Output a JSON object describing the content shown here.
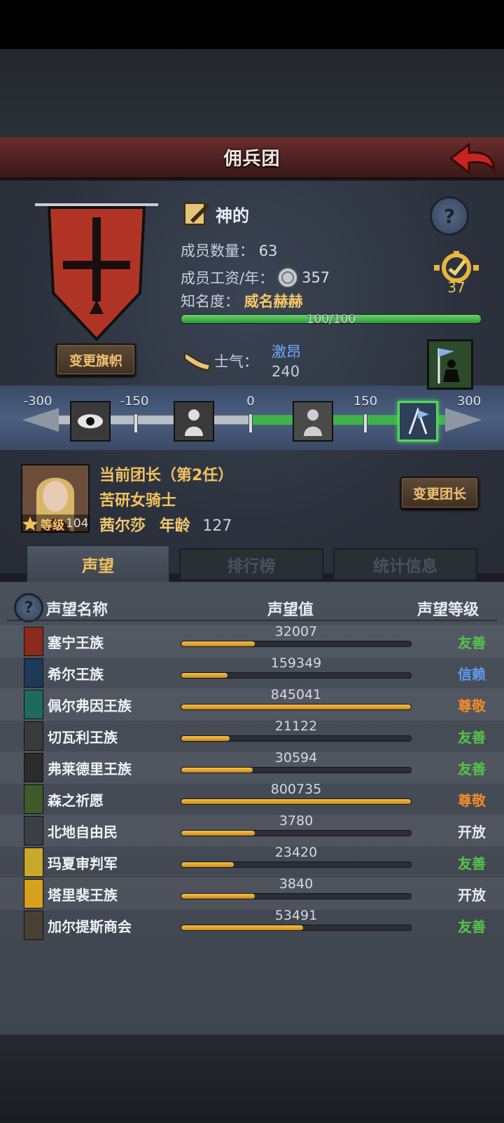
{
  "header": {
    "title": "佣兵团"
  },
  "company": {
    "name": "神的",
    "members_label": "成员数量：",
    "members_value": "63",
    "wage_label": "成员工资/年：",
    "wage_value": "357",
    "fame_label": "知名度：",
    "fame_value": "威名赫赫",
    "fame_progress_text": "100/100",
    "fame_progress": 1.0,
    "badge_value": "37",
    "change_banner_label": "变更旗帜"
  },
  "morale": {
    "label": "士气：",
    "state": "激昂",
    "value": "240",
    "scale_ticks": [
      "-300",
      "-150",
      "0",
      "150",
      "300"
    ]
  },
  "leader": {
    "title": "当前团长（第2任）",
    "class": "苦研女骑士",
    "name": "茜尔莎",
    "age_label": "年龄",
    "age_value": "127",
    "level_label": "等级",
    "level_value": "104",
    "change_leader_label": "变更团长"
  },
  "tabs": [
    {
      "label": "声望"
    },
    {
      "label": "排行榜"
    },
    {
      "label": "统计信息"
    }
  ],
  "reputation": {
    "col_name": "声望名称",
    "col_value": "声望值",
    "col_level": "声望等级",
    "rows": [
      {
        "name": "塞宁王族",
        "value": "32007",
        "progress": 0.32,
        "level": "友善",
        "level_color": "#55c24a",
        "crest_color": "#8a2a1c"
      },
      {
        "name": "希尔王族",
        "value": "159349",
        "progress": 0.2,
        "level": "信赖",
        "level_color": "#5d9cf0",
        "crest_color": "#1f3a58"
      },
      {
        "name": "佩尔弗因王族",
        "value": "845041",
        "progress": 1.0,
        "level": "尊敬",
        "level_color": "#f08a2a",
        "crest_color": "#1e6a5e"
      },
      {
        "name": "切瓦利王族",
        "value": "21122",
        "progress": 0.21,
        "level": "友善",
        "level_color": "#55c24a",
        "crest_color": "#3a3a3a"
      },
      {
        "name": "弗莱德里王族",
        "value": "30594",
        "progress": 0.31,
        "level": "友善",
        "level_color": "#55c24a",
        "crest_color": "#2b2b2b"
      },
      {
        "name": "森之祈愿",
        "value": "800735",
        "progress": 1.0,
        "level": "尊敬",
        "level_color": "#f08a2a",
        "crest_color": "#3d5a28"
      },
      {
        "name": "北地自由民",
        "value": "3780",
        "progress": 0.32,
        "level": "开放",
        "level_color": "#e8ecf2",
        "crest_color": "#3a3f47"
      },
      {
        "name": "玛夏审判军",
        "value": "23420",
        "progress": 0.23,
        "level": "友善",
        "level_color": "#55c24a",
        "crest_color": "#c9a82a"
      },
      {
        "name": "塔里裴王族",
        "value": "3840",
        "progress": 0.32,
        "level": "开放",
        "level_color": "#e8ecf2",
        "crest_color": "#d6a21c"
      },
      {
        "name": "加尔提斯商会",
        "value": "53491",
        "progress": 0.53,
        "level": "友善",
        "level_color": "#55c24a",
        "crest_color": "#4a4034"
      }
    ]
  }
}
